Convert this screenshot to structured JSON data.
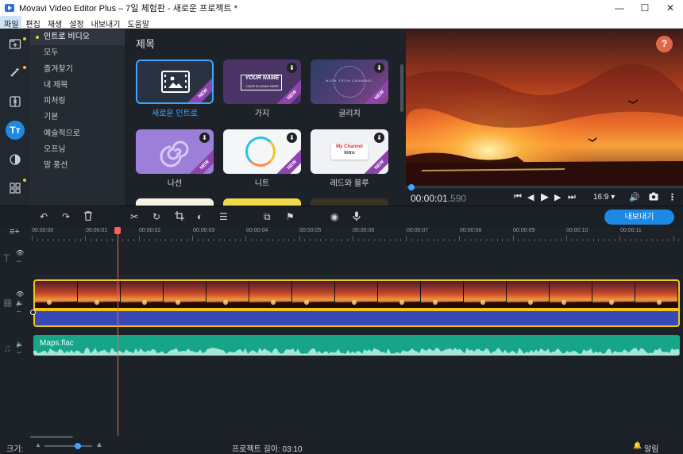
{
  "window": {
    "title": "Movavi Video Editor Plus – 7일 체험판 - 새로운 프로젝트 *"
  },
  "window_controls": {
    "minimize": "—",
    "maximize": "☐",
    "close": "✕"
  },
  "menu": {
    "items": [
      "파일",
      "편집",
      "재생",
      "설정",
      "내보내기",
      "도움말"
    ]
  },
  "sidebar": {
    "icons": [
      "import-icon",
      "magic-wand-icon",
      "transitions-icon",
      "titles-icon",
      "filters-icon",
      "more-tools-icon"
    ],
    "titles_icon_text": "Tт"
  },
  "categories": [
    "인트로 비디오",
    "모두",
    "즐겨찾기",
    "내 제목",
    "피처링",
    "기본",
    "예술적으로",
    "오프닝",
    "말 풍선"
  ],
  "gallery": {
    "heading": "제목",
    "tiles": [
      {
        "label": "새로운 인트로",
        "new_badge": "NEW",
        "download": false
      },
      {
        "label": "가지",
        "new_badge": "NEW",
        "download": true,
        "thumb_text": "YOUR NAME",
        "thumb_sub": "YOUR SLOGAN HERE"
      },
      {
        "label": "글리치",
        "new_badge": "NEW",
        "download": true,
        "thumb_text": "HIGH TECH CHANNEL"
      },
      {
        "label": "나선",
        "new_badge": "NEW",
        "download": true
      },
      {
        "label": "니트",
        "new_badge": "NEW",
        "download": true
      },
      {
        "label": "레드와 블루",
        "new_badge": "NEW",
        "download": true,
        "thumb_text": "My Channel",
        "thumb_sub": "Intro"
      }
    ]
  },
  "preview": {
    "help": "?",
    "time_main": "00:00:01",
    "time_ms": ".590",
    "aspect": "16:9 ▾",
    "progress": 0.0
  },
  "toolbar": {
    "export_label": "내보내기"
  },
  "ruler": {
    "labels": [
      "00:00:00",
      "00:00:01",
      "00:00:02",
      "00:00:03",
      "00:00:04",
      "00:00:05",
      "00:00:06",
      "00:00:07",
      "00:00:08",
      "00:00:09",
      "00:00:10",
      "00:00:11"
    ]
  },
  "timeline": {
    "audio_clip_name": "Maps.flac"
  },
  "status": {
    "zoom_label": "크기:",
    "project_length": "프로젝트 길이:  03:10",
    "notifications": "알림"
  },
  "colors": {
    "accent": "#1e88e5",
    "clip_border": "#f0c419",
    "audio": "#17a58a",
    "playhead": "#ff5c5c",
    "help": "#e2674a"
  }
}
